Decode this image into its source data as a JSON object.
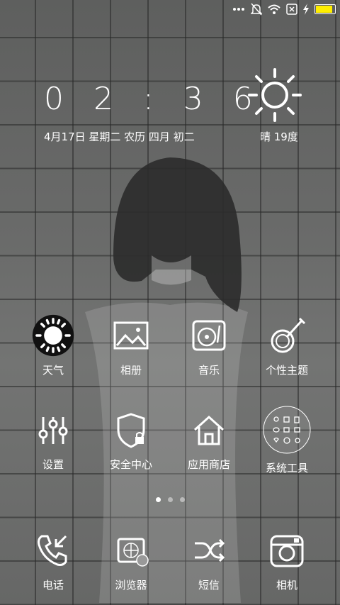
{
  "lockscreen": {
    "time": "0 2 : 3 6",
    "date": "4月17日 星期二  农历 四月 初二",
    "weather": "晴 19度"
  },
  "status_bar": {
    "icons": [
      "more-dots-icon",
      "mute-bell-icon",
      "wifi-icon",
      "sim-x-icon",
      "charging-icon",
      "battery-icon"
    ],
    "battery_level": 0.9,
    "battery_color": "#ffee00"
  },
  "apps": [
    {
      "label": "天气",
      "icon": "sun-icon"
    },
    {
      "label": "相册",
      "icon": "picture-icon"
    },
    {
      "label": "音乐",
      "icon": "turntable-icon"
    },
    {
      "label": "个性主题",
      "icon": "banjo-icon"
    },
    {
      "label": "设置",
      "icon": "sliders-icon"
    },
    {
      "label": "安全中心",
      "icon": "shield-lock-icon"
    },
    {
      "label": "应用商店",
      "icon": "home-store-icon"
    },
    {
      "label": "系统工具",
      "icon": "tools-folder-icon"
    }
  ],
  "page_indicator": {
    "total": 3,
    "active": 1
  },
  "dock": [
    {
      "label": "电话",
      "icon": "phone-icon"
    },
    {
      "label": "浏览器",
      "icon": "browser-icon"
    },
    {
      "label": "短信",
      "icon": "shuffle-icon"
    },
    {
      "label": "相机",
      "icon": "camera-icon"
    }
  ]
}
